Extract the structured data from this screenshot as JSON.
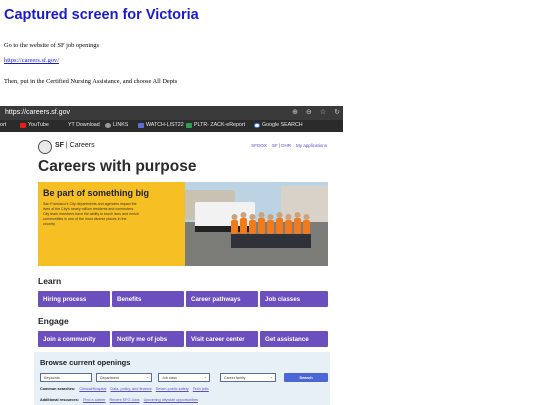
{
  "doc": {
    "title": "Captured screen for Victoria",
    "instruction_1": "Go to the website of SF job openings",
    "link": "https://careers.sf.gov/",
    "instruction_2": "Then, put in the Certified Nursing Assistance, and choose All Depts"
  },
  "browser": {
    "url": "https://careers.sf.gov",
    "bookmarks": [
      {
        "label": "ort",
        "icon": "none",
        "color": ""
      },
      {
        "label": "YouTube",
        "icon": "youtube-icon",
        "color": "#e62117"
      },
      {
        "label": "YT Download",
        "icon": "download-icon",
        "color": "#666666"
      },
      {
        "label": "LINKS",
        "icon": "globe-icon",
        "color": "#9a9a9a"
      },
      {
        "label": "WATCH-LIST22",
        "icon": "list-icon",
        "color": "#5a6fd6"
      },
      {
        "label": "PLTR- ZACK-eReport",
        "icon": "triangle-icon",
        "color": "#2e9e4f"
      },
      {
        "label": "Google SEARCH",
        "icon": "google-icon",
        "color": "#ffffff"
      }
    ]
  },
  "site": {
    "org": "SF",
    "section": "Careers",
    "top_links": [
      "SFDOX",
      "SF | DHR",
      "My applications"
    ],
    "hero_title": "Careers with purpose",
    "hero_heading": "Be part of something big",
    "hero_text": "San Francisco's City departments and agencies impact the lives of the City's nearly million residents and commuters. City team members have the ability to touch lives and enrich communities in one of the most diverse places in the country.",
    "learn_heading": "Learn",
    "learn_buttons": [
      "Hiring process",
      "Benefits",
      "Career pathways",
      "Job classes"
    ],
    "engage_heading": "Engage",
    "engage_buttons": [
      "Join a community",
      "Notify me of jobs",
      "Visit career center",
      "Get assistance"
    ],
    "browse": {
      "title": "Browse current openings",
      "keywords_placeholder": "Keywords",
      "department_placeholder": "Department",
      "job_class_label": "Job class",
      "career_family_label": "Career family",
      "search_label": "Search",
      "common_label": "Common searches:",
      "common_links": [
        "Clinical/Hospital",
        "Data, policy, and finance",
        "Seven public safety",
        "Tech jobs"
      ],
      "additional_label": "Additional resources:",
      "additional_links": [
        "Find a career",
        "Recent SFO Jobs",
        "Upcoming citywide opportunities"
      ]
    }
  },
  "colors": {
    "doc_title": "#1a1acc",
    "hero_yellow": "#f6c025",
    "button_purple": "#6b4fbe",
    "search_blue": "#4b67d6",
    "browse_bg": "#e7f0f6"
  }
}
